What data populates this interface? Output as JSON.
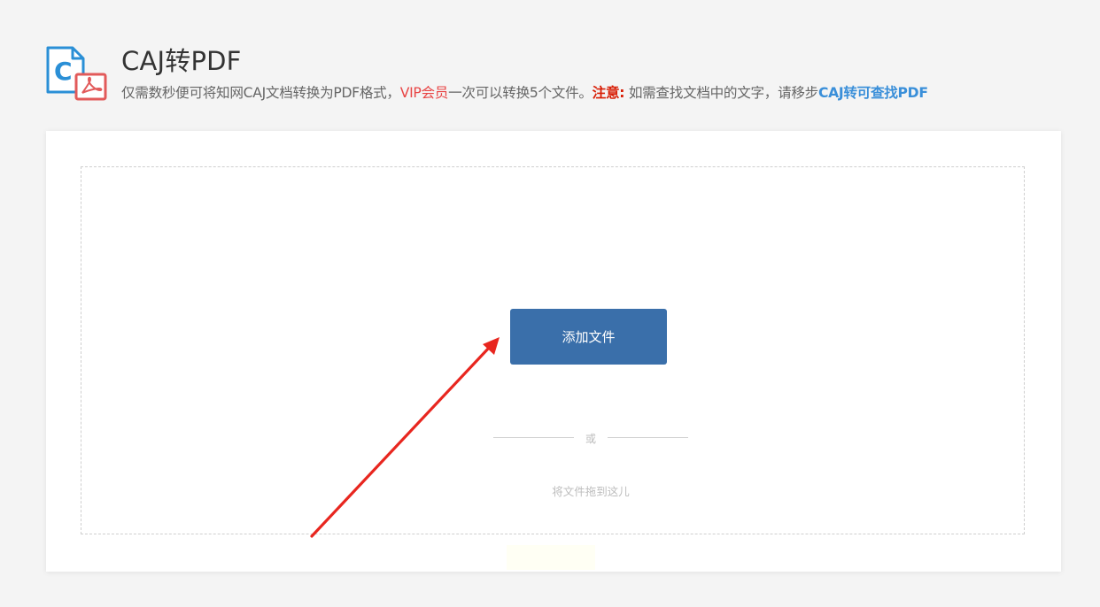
{
  "header": {
    "title": "CAJ转PDF",
    "subtitle": {
      "part1": "仅需数秒便可将知网CAJ文档转换为PDF格式，",
      "vip": "VIP会员",
      "part2": "一次可以转换5个文件。",
      "note": "注意:",
      "part3": " 如需查找文档中的文字，请移步",
      "link": "CAJ转可查找PDF"
    },
    "logo_icon": "caj-to-pdf-logo-icon"
  },
  "upload": {
    "add_button": "添加文件",
    "or_text": "或",
    "drag_hint": "将文件拖到这儿"
  },
  "annotation": {
    "arrow_icon": "red-arrow-icon",
    "arrow_color": "#e8261f"
  },
  "colors": {
    "button": "#3a6faa",
    "vip": "#e84545",
    "note": "#d81e06",
    "link": "#3a8fd9",
    "logo_blue": "#2a8fd6",
    "logo_red": "#e25a5a"
  }
}
